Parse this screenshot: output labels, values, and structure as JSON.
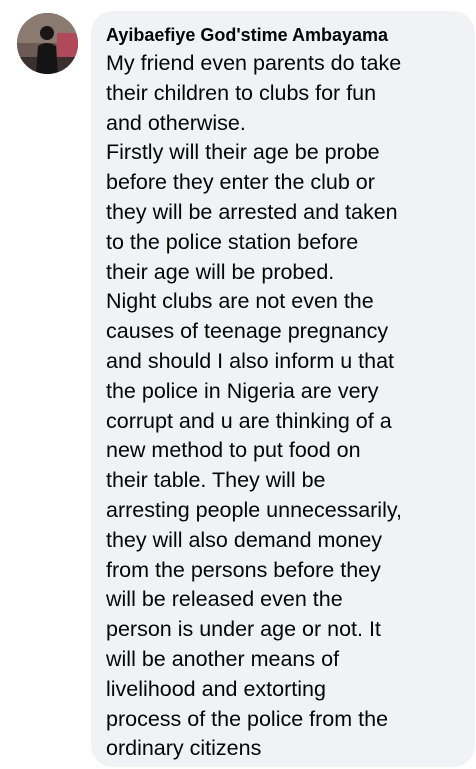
{
  "comment": {
    "author": "Ayibaefiye God'stime Ambayama",
    "avatar_icon": "profile-photo",
    "colors": {
      "bubble_background": "#f0f2f5",
      "text": "#050505"
    },
    "text_lines": [
      "My friend even parents do take",
      "their children to clubs for fun",
      "and otherwise.",
      "Firstly will their age be probe",
      "before they enter the club or",
      "they will be arrested and taken",
      "to the police station before",
      "their age will be probed.",
      "Night clubs are not even the",
      "causes of teenage pregnancy",
      "and should I also inform u that",
      "the police in Nigeria are very",
      "corrupt and u are thinking of a",
      "new method to put food on",
      "their table. They will be",
      "arresting people unnecessarily,",
      "they will also demand money",
      "from the persons before they",
      "will be released even the",
      "person is under age or not. It",
      "will be another means of",
      "livelihood and extorting",
      "process of the police from the",
      "ordinary citizens"
    ]
  }
}
